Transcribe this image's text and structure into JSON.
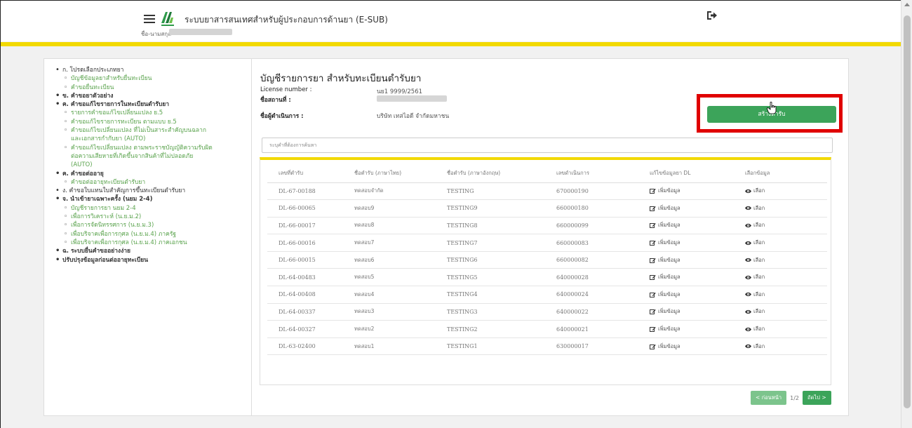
{
  "header": {
    "app_title": "ระบบยาสารสนเทศสำหรับผู้ประกอบการด้านยา (E-SUB)",
    "user_label": "ชื่อ-นามสกุล",
    "icons": {
      "menu": "hamburger-icon",
      "logo": "fda-logo",
      "logout": "sign-out-icon"
    },
    "accent_color": "#f2d900"
  },
  "sidebar": {
    "items": [
      {
        "level": 0,
        "label": "ก. โปรดเลือกประเภทยา",
        "bold": false
      },
      {
        "level": 1,
        "label": "บัญชีข้อมูลยาสำหรับยื่นทะเบียน"
      },
      {
        "level": 1,
        "label": "คำขอยื่นทะเบียน"
      },
      {
        "level": 0,
        "label": "ข. คำขอยาตัวอย่าง",
        "bold": true
      },
      {
        "level": 0,
        "label": "ค. คำขอแก้ไขรายการในทะเบียนตำรับยา",
        "bold": true
      },
      {
        "level": 1,
        "label": "รายการคำขอแก้ไขเปลี่ยนแปลง ย.5"
      },
      {
        "level": 1,
        "label": "คำขอแก้ไขรายการทะเบียน ตามแบบ ย.5"
      },
      {
        "level": 1,
        "label": "คำขอแก้ไขเปลี่ยนแปลง ที่ไม่เป็นสาระสำคัญบนฉลาก"
      },
      {
        "level": 1,
        "label": "และเอกสารกำกับยา (AUTO)",
        "cont": true
      },
      {
        "level": 1,
        "label": "คำขอแก้ไขเปลี่ยนแปลง ตามพระราชบัญญัติความรับผิด"
      },
      {
        "level": 1,
        "label": "ต่อความเสียหายที่เกิดขึ้นจากสินค้าที่ไม่ปลอดภัย",
        "cont": true
      },
      {
        "level": 1,
        "label": "(AUTO)",
        "cont": true
      },
      {
        "level": 0,
        "label": "ค. คำขอต่ออายุ",
        "bold": true
      },
      {
        "level": 1,
        "label": "คำขอต่ออายุทะเบียนตำรับยา"
      },
      {
        "level": 0,
        "label": "ง. คำขอใบแทนใบสำคัญการขึ้นทะเบียนตำรับยา",
        "bold": false
      },
      {
        "level": 0,
        "label": "จ. นำเข้ายาเฉพาะครั้ง (นยม 2-4)",
        "bold": true
      },
      {
        "level": 1,
        "label": "บัญชีรายการยา นยม 2-4"
      },
      {
        "level": 1,
        "label": "เพื่อการวิเคราะห์ (น.ย.ม.2)"
      },
      {
        "level": 1,
        "label": "เพื่อการจัดนิทรรศการ (น.ย.ม.3)"
      },
      {
        "level": 1,
        "label": "เพื่อบริจาคเพื่อการกุศล (น.ย.ม.4) ภาครัฐ"
      },
      {
        "level": 1,
        "label": "เพื่อบริจาคเพื่อการกุศล (น.ย.ม.4) ภาคเอกชน"
      },
      {
        "level": 0,
        "label": "ฉ. ระบบยื่นคำขออย่างง่าย",
        "bold": true
      },
      {
        "level": 0,
        "label": "ปรับปรุงข้อมูลก่อนต่ออายุทะเบียน",
        "bold": true
      }
    ]
  },
  "main": {
    "title": "บัญชีรายการยา สำหรับทะเบียนตำรับยา",
    "license_label": "License number :",
    "license_value": "นย1 9999/2561",
    "place_label": "ชื่อสถานที่ :",
    "operator_label": "ชื่อผู้ดำเนินการ :",
    "operator_value": "บริษัท เทสไอดี จำกัดมหาชน",
    "create_button": "สร้างตำรับ",
    "search_placeholder": "ระบุคำที่ต้องการค้นหา",
    "table": {
      "headers": [
        "เลขที่ตำรับ",
        "ชื่อตำรับ (ภาษาไทย)",
        "ชื่อตำรับ (ภาษาอังกฤษ)",
        "เลขดำเนินการ",
        "แก้ไขข้อมูลยา DL",
        "เลือกข้อมูล"
      ],
      "edit_label": "เพิ่มข้อมูล",
      "select_label": "เลือก",
      "rows": [
        [
          "DL-67-00188",
          "ทดสอบจำกัด",
          "TESTING",
          "670000190"
        ],
        [
          "DL-66-00065",
          "ทดสอบ9",
          "TESTING9",
          "660000180"
        ],
        [
          "DL-66-00017",
          "ทดสอบ8",
          "TESTING8",
          "660000099"
        ],
        [
          "DL-66-00016",
          "ทดสอบ7",
          "TESTING7",
          "660000083"
        ],
        [
          "DL-66-00015",
          "ทดสอบ6",
          "TESTING6",
          "660000082"
        ],
        [
          "DL-64-00483",
          "ทดสอบ5",
          "TESTING5",
          "640000028"
        ],
        [
          "DL-64-00408",
          "ทดสอบ4",
          "TESTING4",
          "640000024"
        ],
        [
          "DL-64-00337",
          "ทดสอบ3",
          "TESTING3",
          "640000022"
        ],
        [
          "DL-64-00327",
          "ทดสอบ2",
          "TESTING2",
          "640000021"
        ],
        [
          "DL-63-02400",
          "ทดสอบ1",
          "TESTING1",
          "630000017"
        ]
      ]
    },
    "pager": {
      "prev": "< ก่อนหน้า",
      "page": "1/2",
      "next": "ถัดไป >"
    },
    "button_color": "#3ca45a",
    "highlight_color": "#e00000"
  }
}
